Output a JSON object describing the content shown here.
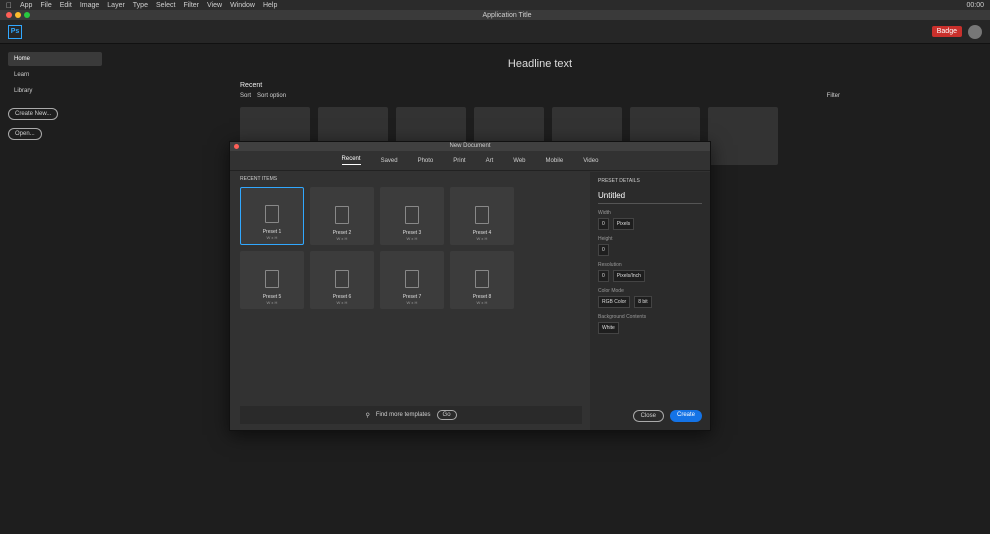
{
  "menubar": {
    "app": "App",
    "items": [
      "File",
      "Edit",
      "Image",
      "Layer",
      "Type",
      "Select",
      "Filter",
      "View",
      "Window",
      "Help"
    ],
    "clock": "00:00"
  },
  "window": {
    "title": "Application Title"
  },
  "appbar": {
    "logo": "Ps",
    "badge": "Badge"
  },
  "sidebar": {
    "items": [
      {
        "label": "Home"
      },
      {
        "label": "Learn"
      },
      {
        "label": "Library"
      }
    ],
    "new_label": "Create New...",
    "open_label": "Open..."
  },
  "main": {
    "headline": "Headline text",
    "recent_label": "Recent",
    "sort_label": "Sort",
    "sort_value": "Sort option",
    "filter_label": "Filter"
  },
  "dialog": {
    "title": "New Document",
    "tabs": [
      {
        "label": "Recent"
      },
      {
        "label": "Saved"
      },
      {
        "label": "Photo"
      },
      {
        "label": "Print"
      },
      {
        "label": "Art"
      },
      {
        "label": "Web"
      },
      {
        "label": "Mobile"
      },
      {
        "label": "Video"
      }
    ],
    "section_label": "RECENT ITEMS",
    "presets": [
      {
        "name": "Preset 1",
        "dims": "W x H"
      },
      {
        "name": "Preset 2",
        "dims": "W x H"
      },
      {
        "name": "Preset 3",
        "dims": "W x H"
      },
      {
        "name": "Preset 4",
        "dims": "W x H"
      },
      {
        "name": "Preset 5",
        "dims": "W x H"
      },
      {
        "name": "Preset 6",
        "dims": "W x H"
      },
      {
        "name": "Preset 7",
        "dims": "W x H"
      },
      {
        "name": "Preset 8",
        "dims": "W x H"
      }
    ],
    "search_placeholder": "Find more templates",
    "go_label": "Go",
    "details": {
      "section": "PRESET DETAILS",
      "name": "Untitled",
      "width_label": "Width",
      "width": "0",
      "width_unit": "Pixels",
      "height_label": "Height",
      "height": "0",
      "resolution_label": "Resolution",
      "resolution": "0",
      "resolution_unit": "Pixels/Inch",
      "mode_label": "Color Mode",
      "mode": "RGB Color",
      "depth": "8 bit",
      "bg_label": "Background Contents",
      "bg": "White",
      "close_label": "Close",
      "create_label": "Create"
    }
  }
}
